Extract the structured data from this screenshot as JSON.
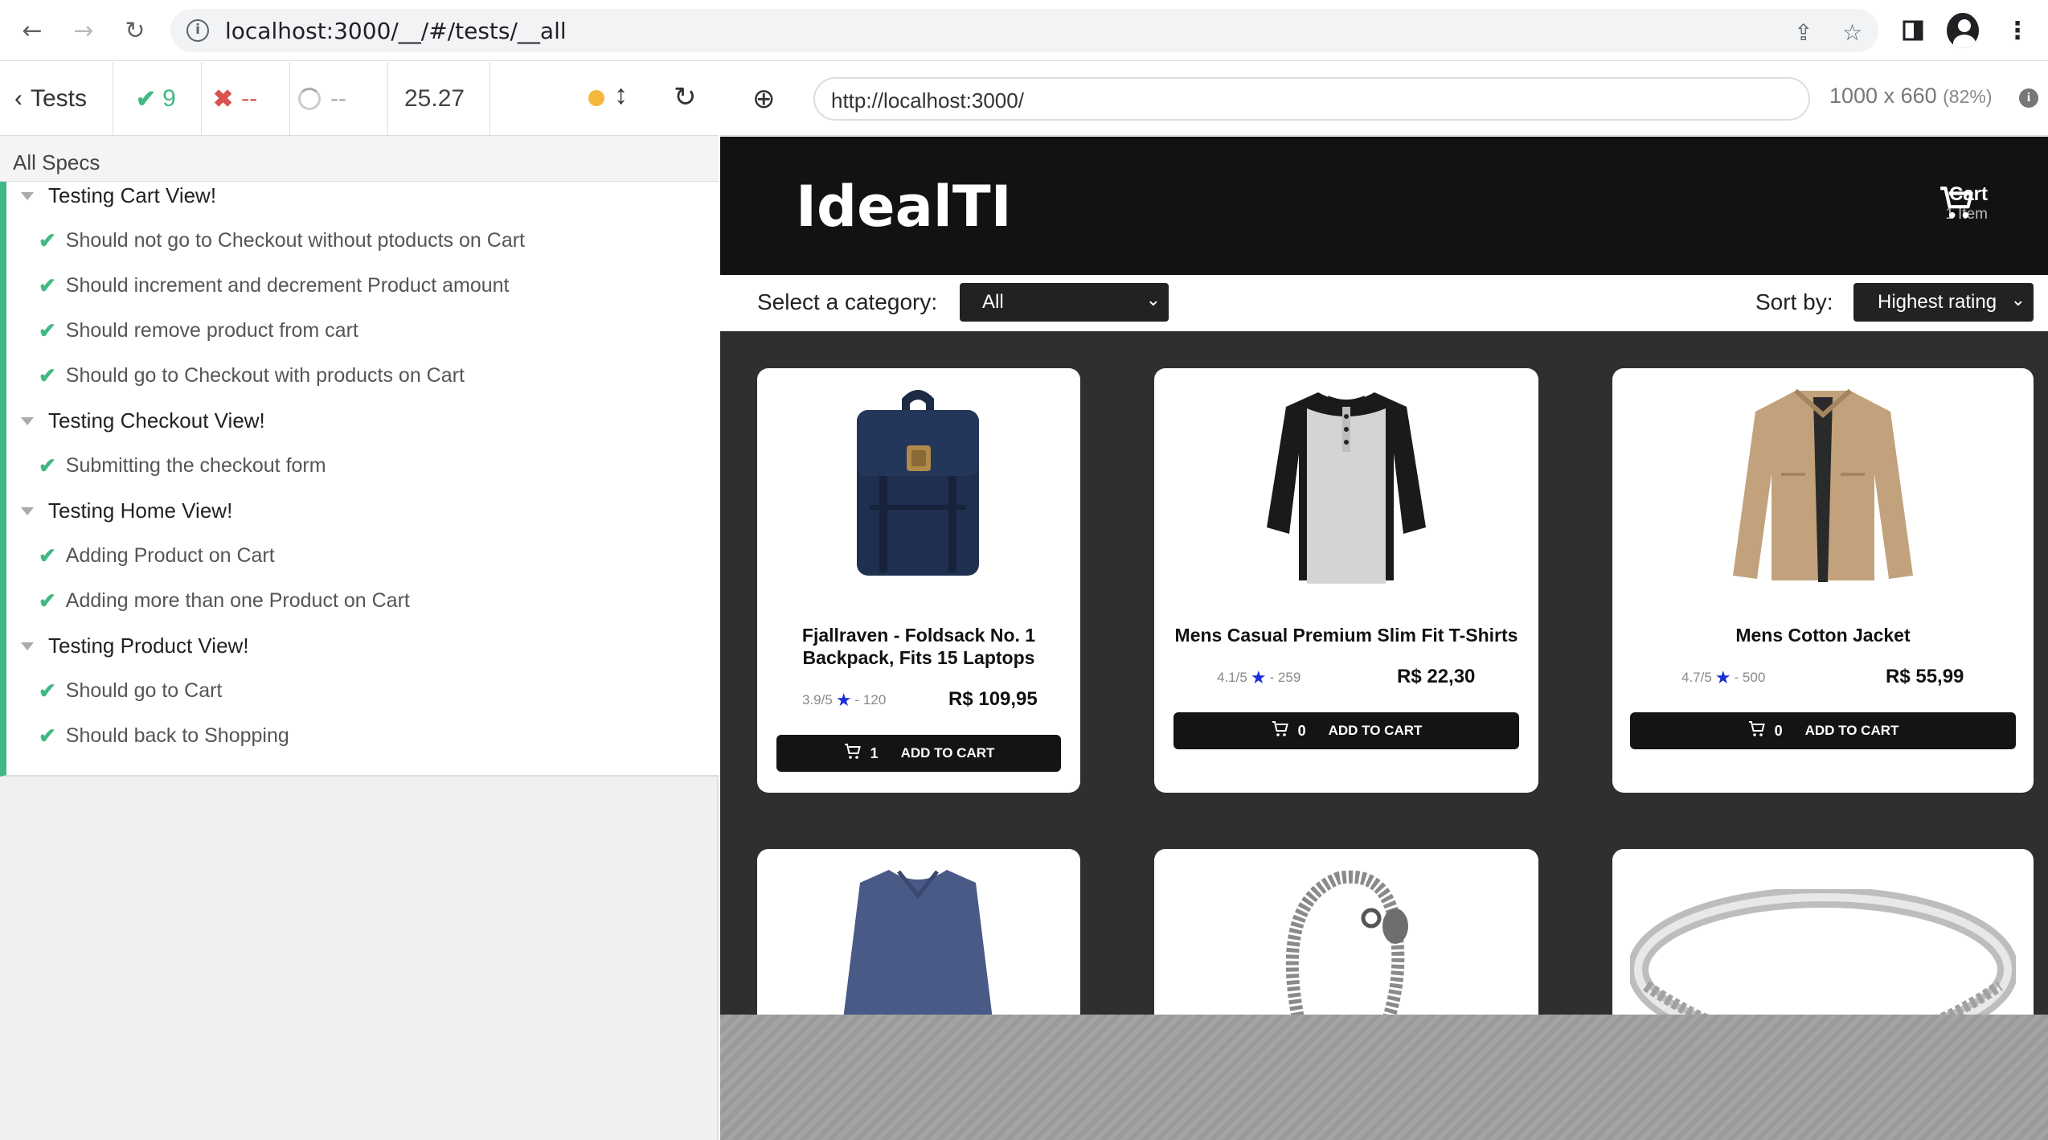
{
  "browser": {
    "url": "localhost:3000/__/#/tests/__all"
  },
  "reporter": {
    "back_label": "Tests",
    "passed": "9",
    "failed": "--",
    "pending": "--",
    "duration": "25.27",
    "all_specs": "All Specs",
    "suites": [
      {
        "title": "Testing Cart View!",
        "tests": [
          "Should not go to Checkout without ptoducts on Cart",
          "Should increment and decrement Product amount",
          "Should remove product from cart",
          "Should go to Checkout with products on Cart"
        ]
      },
      {
        "title": "Testing Checkout View!",
        "tests": [
          "Submitting the checkout form"
        ]
      },
      {
        "title": "Testing Home View!",
        "tests": [
          "Adding Product on Cart",
          "Adding more than one Product on Cart"
        ]
      },
      {
        "title": "Testing Product View!",
        "tests": [
          "Should go to Cart",
          "Should back to Shopping"
        ]
      }
    ]
  },
  "runner": {
    "url": "http://localhost:3000/",
    "size": "1000 x 660",
    "scale": "(82%)"
  },
  "app": {
    "logo": "IdealTI",
    "cart_title": "Cart",
    "cart_items": "1 Item",
    "category_label": "Select a category:",
    "category_value": "All",
    "sort_label": "Sort by:",
    "sort_value": "Highest rating",
    "add_label": "ADD TO CART",
    "products": [
      {
        "title": "Fjallraven - Foldsack No. 1 Backpack, Fits 15 Laptops",
        "rating": "3.9/5",
        "count": "- 120",
        "price": "R$ 109,95",
        "qty": "1"
      },
      {
        "title": "Mens Casual Premium Slim Fit T-Shirts",
        "rating": "4.1/5",
        "count": "- 259",
        "price": "R$ 22,30",
        "qty": "0"
      },
      {
        "title": "Mens Cotton Jacket",
        "rating": "4.7/5",
        "count": "- 500",
        "price": "R$ 55,99",
        "qty": "0"
      }
    ]
  },
  "colors": {
    "pass": "#42b883",
    "fail": "#d9534f",
    "pending_dot": "#f5b83d",
    "star": "#1a2dd8"
  }
}
